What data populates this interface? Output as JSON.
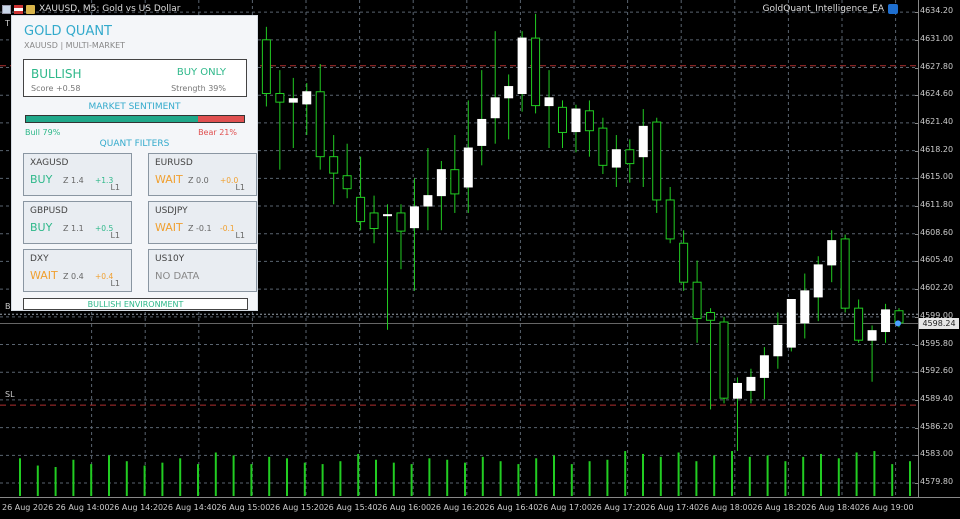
{
  "window": {
    "symbol_title": "XAUUSD, M5:  Gold vs US Dollar",
    "ea_name": "GoldQuant_Intelligence_EA",
    "left_markers": [
      "T",
      "B",
      "SL"
    ]
  },
  "price_axis": {
    "ticks": [
      "4634.20",
      "4631.00",
      "4627.80",
      "4624.60",
      "4621.40",
      "4618.20",
      "4615.00",
      "4611.80",
      "4608.60",
      "4605.40",
      "4602.20",
      "4599.00",
      "4595.80",
      "4592.60",
      "4589.40",
      "4586.20",
      "4583.00",
      "4579.80"
    ],
    "current_price": "4598.24"
  },
  "time_axis": {
    "ticks": [
      "26 Aug 2026",
      "26 Aug 14:00",
      "26 Aug 14:20",
      "26 Aug 14:40",
      "26 Aug 15:00",
      "26 Aug 15:20",
      "26 Aug 15:40",
      "26 Aug 16:00",
      "26 Aug 16:20",
      "26 Aug 16:40",
      "26 Aug 17:00",
      "26 Aug 17:20",
      "26 Aug 17:40",
      "26 Aug 18:00",
      "26 Aug 18:20",
      "26 Aug 18:40",
      "26 Aug 19:00"
    ]
  },
  "colors": {
    "bull_candle": "#ffffff",
    "wick": "#22cc22",
    "grid": "#5a6470",
    "tp_sl_line": "#b03030",
    "accent": "#33aacc",
    "buy": "#2eb88a",
    "wait": "#f0a030",
    "bear": "#e05050"
  },
  "panel": {
    "title": "GOLD QUANT",
    "subtitle": "XAUUSD | MULTI-MARKET",
    "bias": "BULLISH",
    "action": "BUY ONLY",
    "score": "Score +0.58",
    "strength": "Strength 39%",
    "sentiment_header": "MARKET SENTIMENT",
    "bull_pct": 79,
    "bull_label": "Bull 79%",
    "bear_label": "Bear 21%",
    "filters_header": "QUANT FILTERS",
    "filters": [
      {
        "symbol": "XAGUSD",
        "signal": "BUY",
        "z": "Z 1.4",
        "change": "+1.3",
        "level": "L1",
        "state": "buy"
      },
      {
        "symbol": "EURUSD",
        "signal": "WAIT",
        "z": "Z 0.0",
        "change": "+0.0",
        "level": "L1",
        "state": "wait"
      },
      {
        "symbol": "GBPUSD",
        "signal": "BUY",
        "z": "Z 1.1",
        "change": "+0.5",
        "level": "L1",
        "state": "buy"
      },
      {
        "symbol": "USDJPY",
        "signal": "WAIT",
        "z": "Z -0.1",
        "change": "-0.1",
        "level": "L1",
        "state": "wait"
      },
      {
        "symbol": "DXY",
        "signal": "WAIT",
        "z": "Z 0.4",
        "change": "+0.4",
        "level": "L1",
        "state": "wait"
      },
      {
        "symbol": "US10Y",
        "signal": "NO DATA",
        "z": "",
        "change": "",
        "level": "",
        "state": "nodata"
      }
    ],
    "environment": "BULLISH ENVIRONMENT"
  },
  "chart_data": {
    "type": "candlestick",
    "symbol": "XAUUSD",
    "timeframe": "M5",
    "ylim": [
      4578.3,
      4635.6
    ],
    "tp_level": 4628.0,
    "buy_level": 4599.3,
    "sl_level": 4588.8,
    "candles": [
      {
        "o": 4625.1,
        "h": 4630.0,
        "l": 4622.0,
        "c": 4628.2
      },
      {
        "o": 4628.2,
        "h": 4631.2,
        "l": 4622.5,
        "c": 4626.5
      },
      {
        "o": 4626.6,
        "h": 4631.0,
        "l": 4622.0,
        "c": 4631.0
      },
      {
        "o": 4631.0,
        "h": 4632.5,
        "l": 4623.3,
        "c": 4624.8
      },
      {
        "o": 4624.8,
        "h": 4627.5,
        "l": 4616.0,
        "c": 4623.8
      },
      {
        "o": 4623.8,
        "h": 4626.6,
        "l": 4618.5,
        "c": 4624.2
      },
      {
        "o": 4623.6,
        "h": 4626.0,
        "l": 4620.0,
        "c": 4625.0
      },
      {
        "o": 4625.0,
        "h": 4628.2,
        "l": 4616.0,
        "c": 4617.5
      },
      {
        "o": 4617.5,
        "h": 4620.0,
        "l": 4612.0,
        "c": 4615.6
      },
      {
        "o": 4615.3,
        "h": 4619.0,
        "l": 4612.7,
        "c": 4613.8
      },
      {
        "o": 4612.8,
        "h": 4617.5,
        "l": 4609.0,
        "c": 4610.0
      },
      {
        "o": 4611.0,
        "h": 4613.0,
        "l": 4607.5,
        "c": 4609.2
      },
      {
        "o": 4610.8,
        "h": 4612.0,
        "l": 4597.5,
        "c": 4610.8
      },
      {
        "o": 4611.0,
        "h": 4612.0,
        "l": 4604.5,
        "c": 4608.9
      },
      {
        "o": 4609.3,
        "h": 4615.0,
        "l": 4602.0,
        "c": 4611.7
      },
      {
        "o": 4611.8,
        "h": 4618.5,
        "l": 4609.0,
        "c": 4613.0
      },
      {
        "o": 4613.0,
        "h": 4617.0,
        "l": 4609.0,
        "c": 4616.0
      },
      {
        "o": 4616.0,
        "h": 4620.0,
        "l": 4611.0,
        "c": 4613.2
      },
      {
        "o": 4614.0,
        "h": 4624.0,
        "l": 4611.0,
        "c": 4618.5
      },
      {
        "o": 4618.8,
        "h": 4627.5,
        "l": 4616.5,
        "c": 4621.8
      },
      {
        "o": 4622.0,
        "h": 4632.0,
        "l": 4619.0,
        "c": 4624.3
      },
      {
        "o": 4624.3,
        "h": 4627.0,
        "l": 4619.5,
        "c": 4625.6
      },
      {
        "o": 4624.8,
        "h": 4632.0,
        "l": 4622.7,
        "c": 4631.2
      },
      {
        "o": 4631.2,
        "h": 4634.0,
        "l": 4622.5,
        "c": 4623.4
      },
      {
        "o": 4623.4,
        "h": 4627.5,
        "l": 4618.5,
        "c": 4624.3
      },
      {
        "o": 4623.2,
        "h": 4624.0,
        "l": 4618.5,
        "c": 4620.3
      },
      {
        "o": 4620.4,
        "h": 4623.5,
        "l": 4618.0,
        "c": 4623.0
      },
      {
        "o": 4622.8,
        "h": 4624.0,
        "l": 4617.5,
        "c": 4620.5
      },
      {
        "o": 4620.8,
        "h": 4622.0,
        "l": 4615.5,
        "c": 4616.5
      },
      {
        "o": 4616.3,
        "h": 4620.0,
        "l": 4614.0,
        "c": 4618.3
      },
      {
        "o": 4618.3,
        "h": 4619.5,
        "l": 4614.5,
        "c": 4616.7
      },
      {
        "o": 4617.5,
        "h": 4623.0,
        "l": 4614.0,
        "c": 4621.0
      },
      {
        "o": 4621.5,
        "h": 4622.0,
        "l": 4611.0,
        "c": 4612.5
      },
      {
        "o": 4612.5,
        "h": 4614.0,
        "l": 4607.5,
        "c": 4608.0
      },
      {
        "o": 4607.5,
        "h": 4609.0,
        "l": 4602.0,
        "c": 4603.0
      },
      {
        "o": 4603.0,
        "h": 4605.5,
        "l": 4596.0,
        "c": 4598.8
      },
      {
        "o": 4599.5,
        "h": 4600.0,
        "l": 4588.3,
        "c": 4598.6
      },
      {
        "o": 4598.4,
        "h": 4599.0,
        "l": 4589.0,
        "c": 4589.6
      },
      {
        "o": 4589.6,
        "h": 4592.0,
        "l": 4583.5,
        "c": 4591.3
      },
      {
        "o": 4590.5,
        "h": 4593.0,
        "l": 4589.0,
        "c": 4592.0
      },
      {
        "o": 4592.0,
        "h": 4595.5,
        "l": 4589.5,
        "c": 4594.5
      },
      {
        "o": 4594.5,
        "h": 4599.5,
        "l": 4593.0,
        "c": 4598.0
      },
      {
        "o": 4595.5,
        "h": 4601.0,
        "l": 4595.0,
        "c": 4601.0
      },
      {
        "o": 4598.3,
        "h": 4604.0,
        "l": 4596.5,
        "c": 4602.0
      },
      {
        "o": 4601.3,
        "h": 4606.0,
        "l": 4598.5,
        "c": 4605.0
      },
      {
        "o": 4605.0,
        "h": 4609.0,
        "l": 4603.0,
        "c": 4607.8
      },
      {
        "o": 4608.0,
        "h": 4608.5,
        "l": 4599.5,
        "c": 4600.0
      },
      {
        "o": 4600.0,
        "h": 4601.0,
        "l": 4596.0,
        "c": 4596.3
      },
      {
        "o": 4596.3,
        "h": 4598.0,
        "l": 4591.5,
        "c": 4597.4
      },
      {
        "o": 4597.3,
        "h": 4600.5,
        "l": 4596.0,
        "c": 4599.8
      },
      {
        "o": 4599.7,
        "h": 4600.0,
        "l": 4597.8,
        "c": 4598.3
      }
    ],
    "volumes": [
      26,
      21,
      20,
      25,
      22,
      28,
      24,
      21,
      23,
      26,
      22,
      30,
      28,
      22,
      27,
      26,
      23,
      22,
      24,
      29,
      25,
      23,
      22,
      26,
      25,
      23,
      27,
      24,
      22,
      26,
      28,
      22,
      24,
      25,
      31,
      29,
      27,
      30,
      24,
      28,
      31,
      27,
      28,
      24,
      27,
      29,
      26,
      30,
      31,
      22,
      24
    ]
  }
}
